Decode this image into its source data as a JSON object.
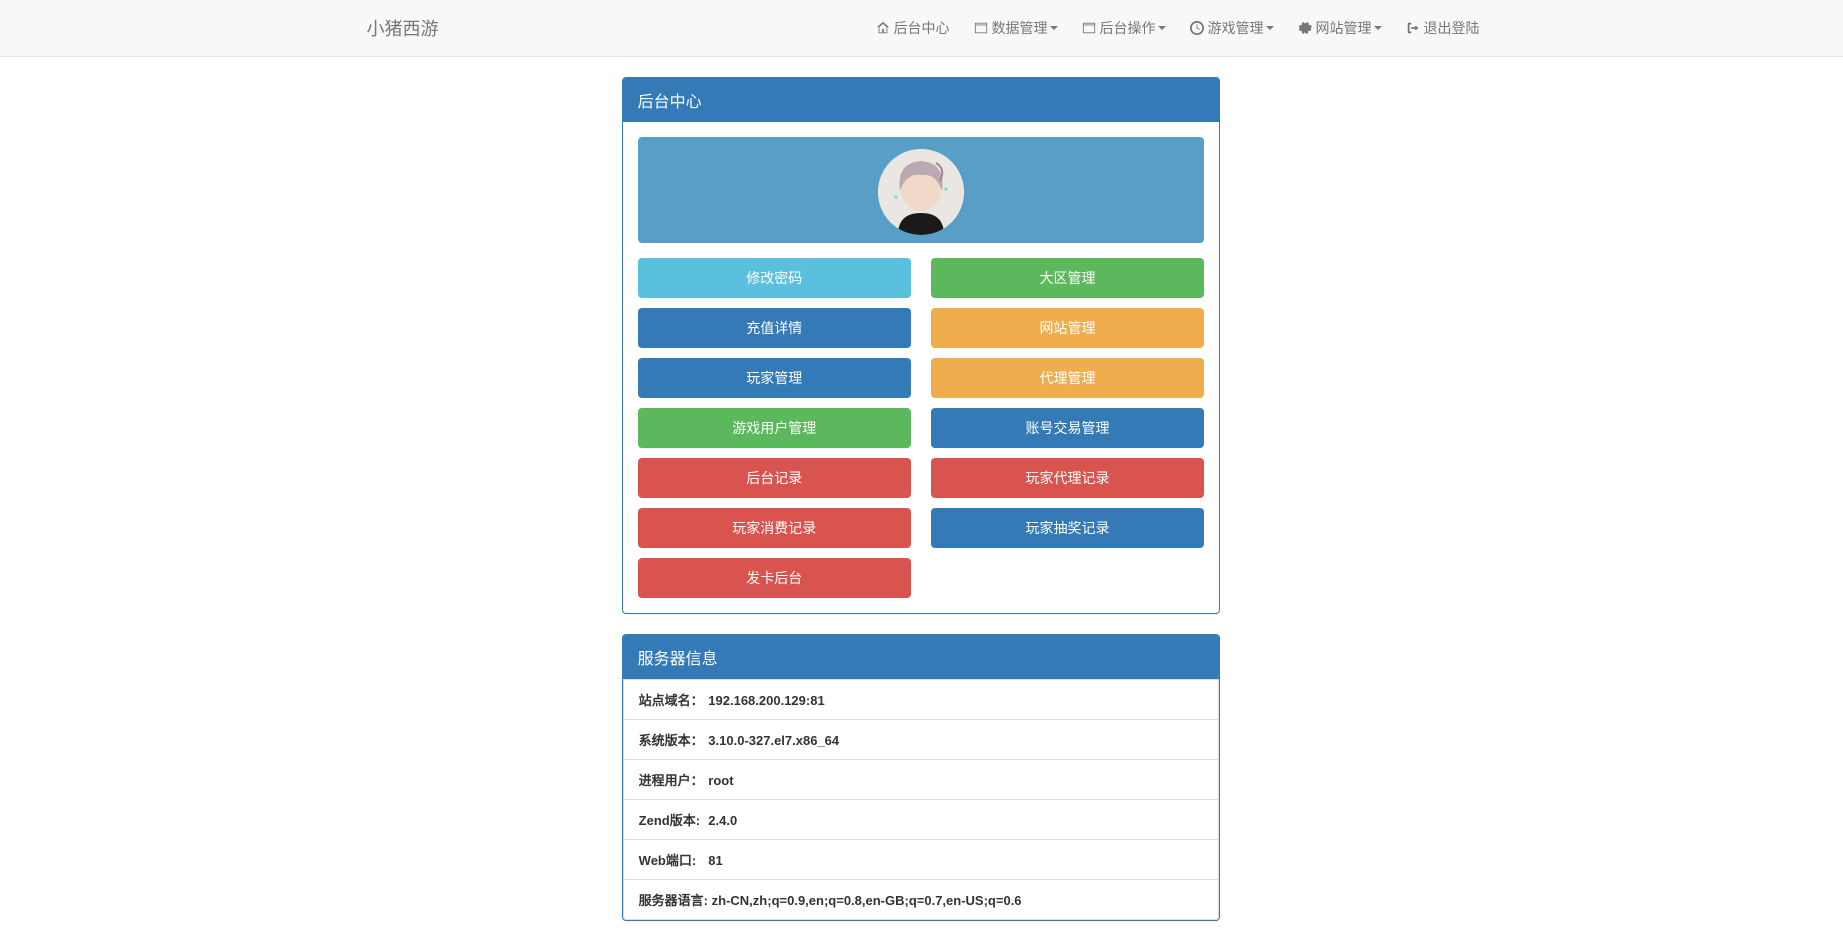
{
  "brand": "小猪西游",
  "nav": {
    "home": "后台中心",
    "data": "数据管理",
    "backend": "后台操作",
    "game": "游戏管理",
    "site": "网站管理",
    "logout": "退出登陆"
  },
  "panel1": {
    "title": "后台中心",
    "buttons": {
      "change_pw": "修改密码",
      "zone_mgmt": "大区管理",
      "recharge": "充值详情",
      "site_mgmt": "网站管理",
      "player_mgmt": "玩家管理",
      "agent_mgmt": "代理管理",
      "game_user_mgmt": "游戏用户管理",
      "account_trade": "账号交易管理",
      "backend_log": "后台记录",
      "player_agent_log": "玩家代理记录",
      "player_spend_log": "玩家消费记录",
      "player_draw_log": "玩家抽奖记录",
      "card_backend": "发卡后台"
    }
  },
  "panel2": {
    "title": "服务器信息",
    "rows": [
      {
        "label": "站点域名：",
        "value": "192.168.200.129:81"
      },
      {
        "label": "系统版本：",
        "value": "3.10.0-327.el7.x86_64"
      },
      {
        "label": "进程用户：",
        "value": "root"
      },
      {
        "label": "Zend版本:",
        "value": "2.4.0"
      },
      {
        "label": "Web端口:",
        "value": "81"
      },
      {
        "label": "服务器语言:",
        "value": "zh-CN,zh;q=0.9,en;q=0.8,en-GB;q=0.7,en-US;q=0.6"
      }
    ]
  }
}
